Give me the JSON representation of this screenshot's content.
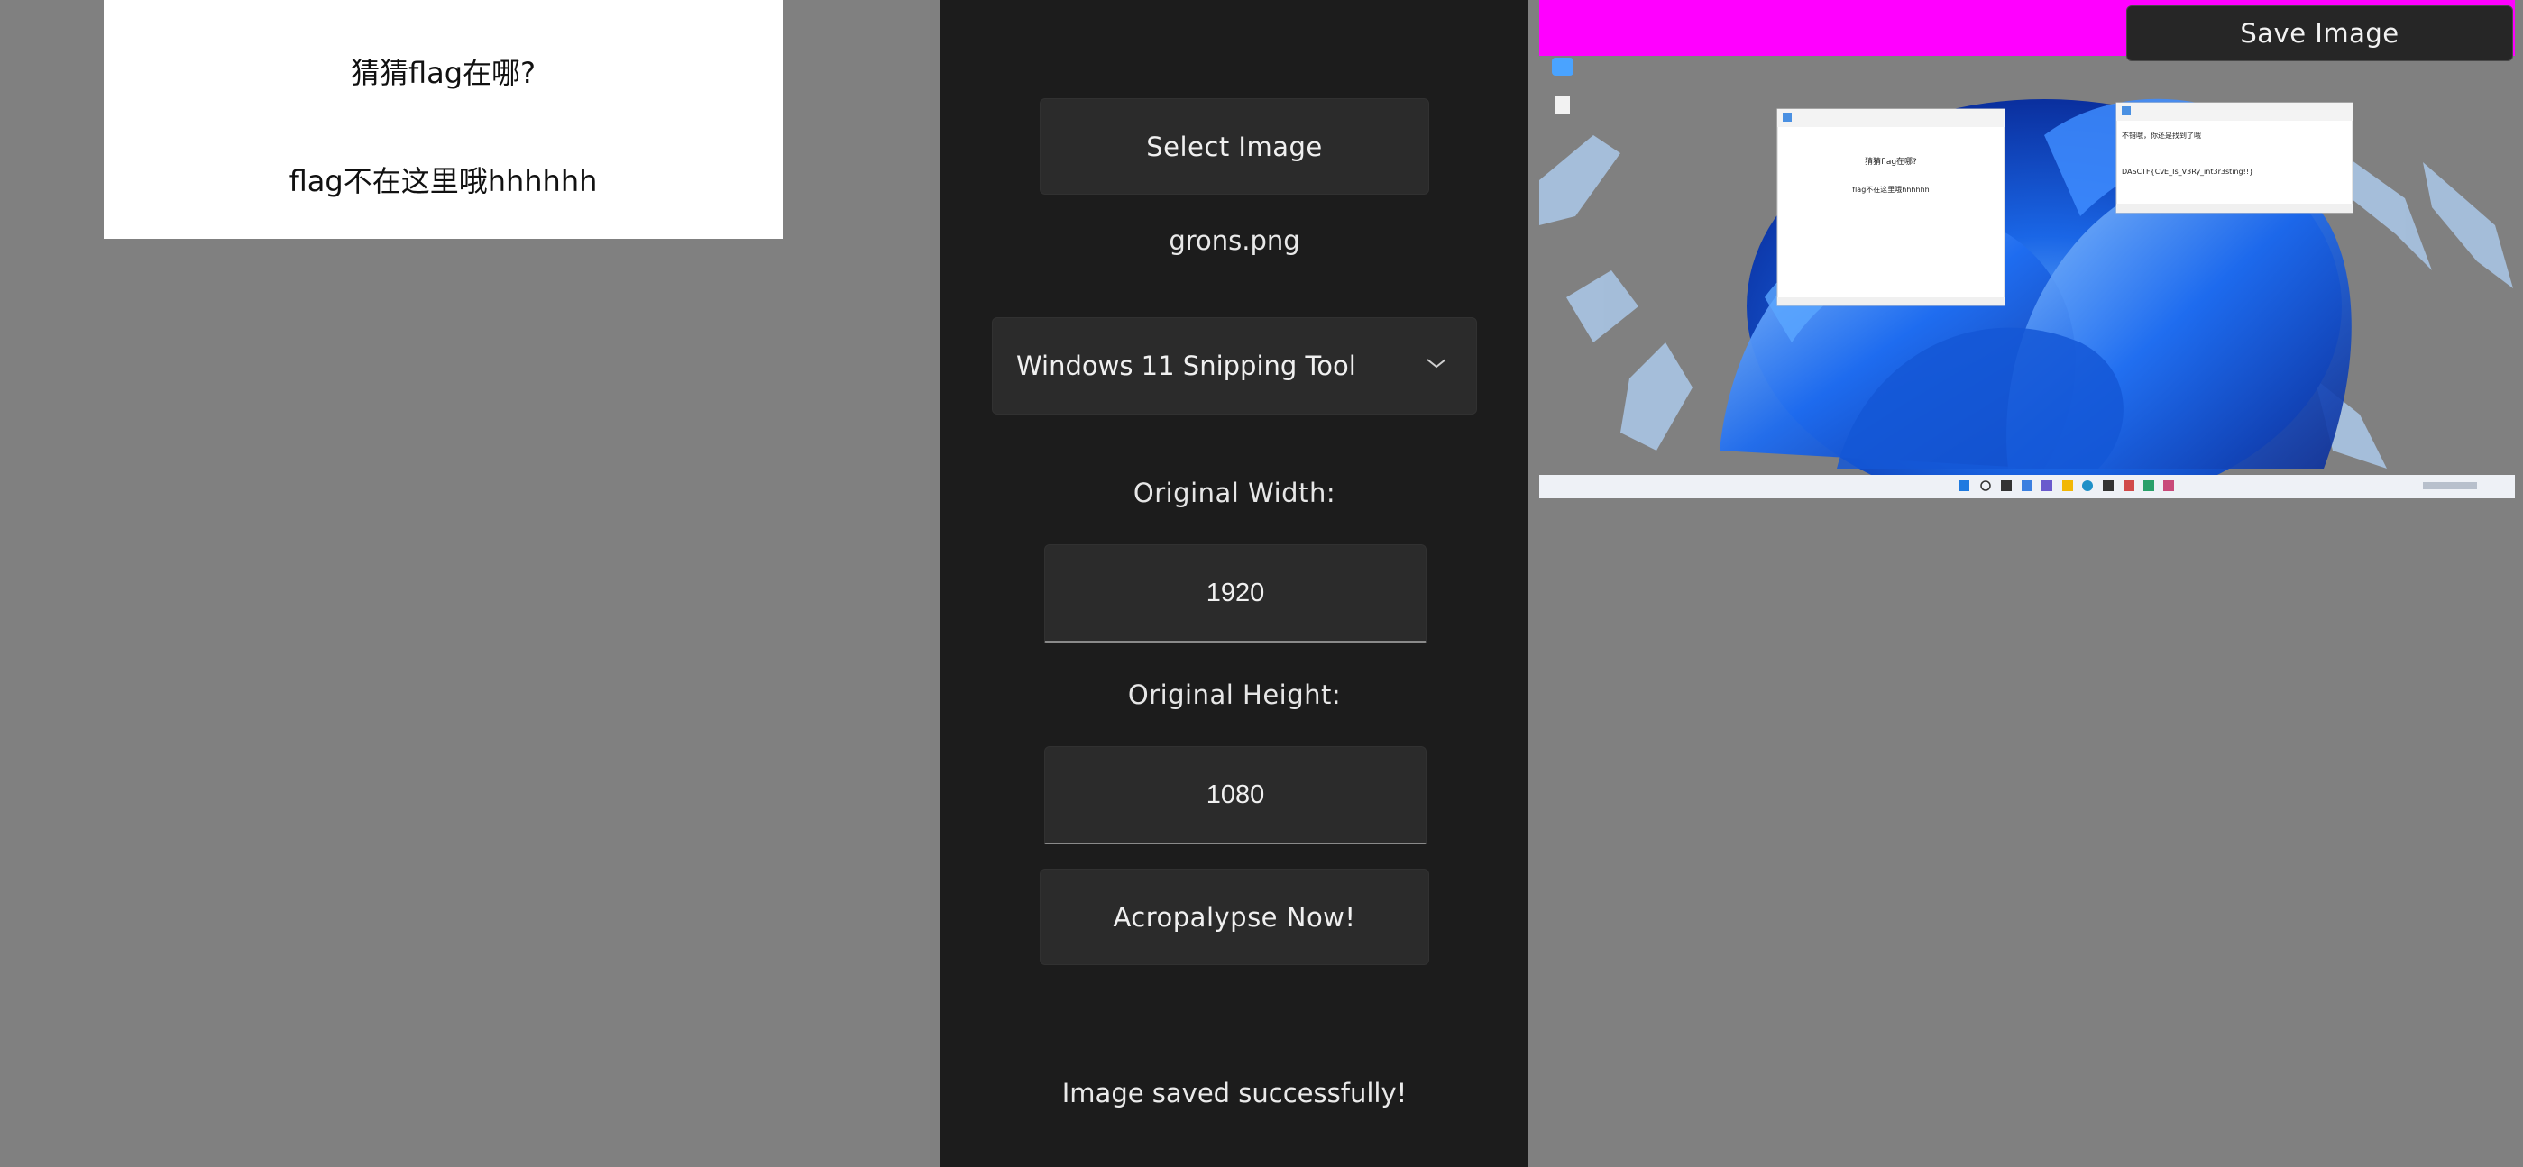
{
  "left_preview": {
    "line1": "猜猜flag在哪?",
    "line2": "flag不在这里哦hhhhhh"
  },
  "panel": {
    "select_image_label": "Select Image",
    "filename": "grons.png",
    "tool_selected": "Windows 11 Snipping Tool",
    "width_label": "Original Width:",
    "width_value": "1920",
    "height_label": "Original Height:",
    "height_value": "1080",
    "acropalypse_label": "Acropalypse Now!",
    "status": "Image saved successfully!"
  },
  "recovered": {
    "save_label": "Save Image",
    "notepad1": {
      "line1": "猜猜flag在哪?",
      "line2": "flag不在这里哦hhhhhh"
    },
    "notepad2": {
      "line1": "不错哦，你还是找到了哦",
      "line2": "DASCTF{CvE_Is_V3Ry_int3r3sting!!}"
    }
  },
  "colors": {
    "background": "#808080",
    "panel": "#1c1c1c",
    "button": "#2b2b2b",
    "magenta": "#ff00ff",
    "desktop_blue": "#1f5fe0"
  },
  "icons": [
    "chevron-down-icon",
    "notepad-icon",
    "file-icon",
    "start-icon",
    "search-icon",
    "edge-icon",
    "store-icon"
  ]
}
